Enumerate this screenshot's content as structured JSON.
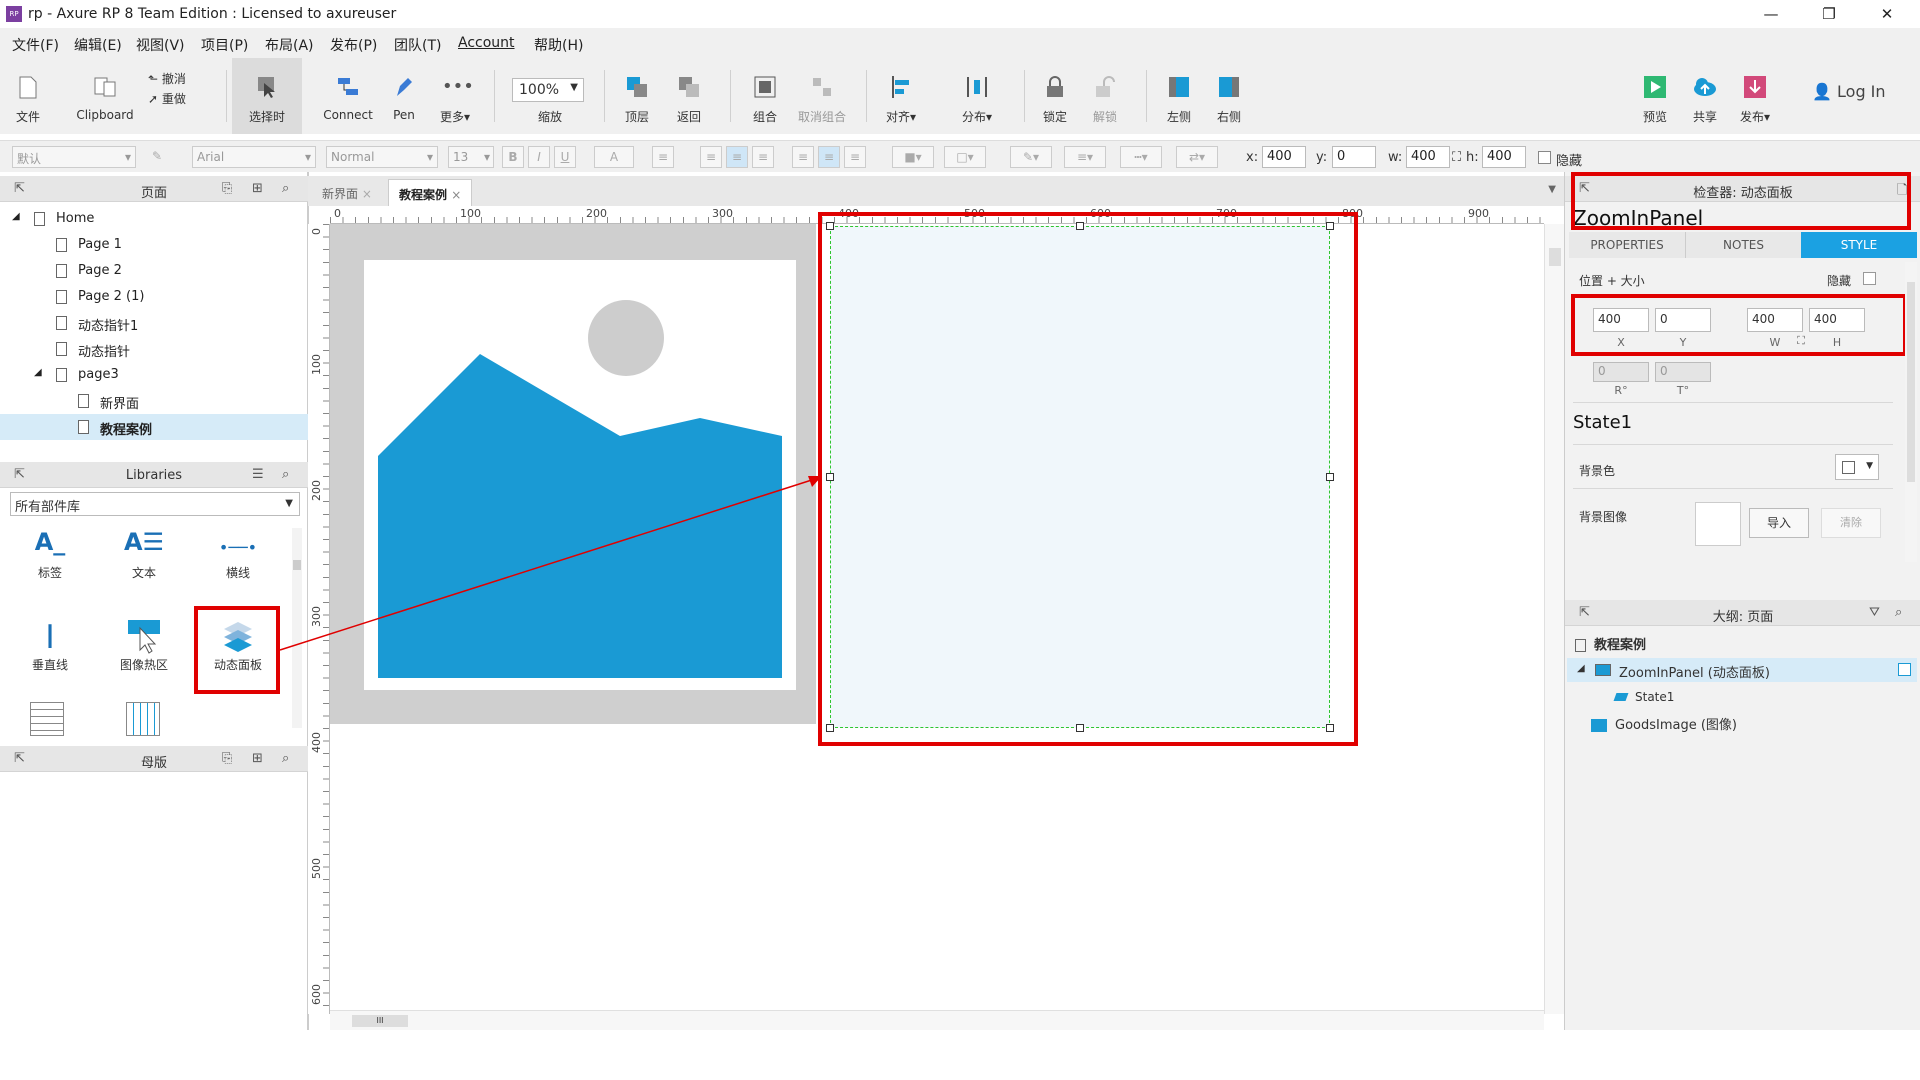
{
  "window": {
    "title": "rp - Axure RP 8 Team Edition : Licensed to axureuser",
    "icon_text": "RP",
    "minimize": "—",
    "maximize": "❐",
    "close": "✕"
  },
  "menu": [
    "文件(F)",
    "编辑(E)",
    "视图(V)",
    "项目(P)",
    "布局(A)",
    "发布(P)",
    "团队(T)",
    "Account",
    "帮助(H)"
  ],
  "toolbar": {
    "file": "文件",
    "clipboard": "Clipboard",
    "undo": "撤消",
    "redo": "重做",
    "select": "选择时",
    "connect": "Connect",
    "pen": "Pen",
    "more": "更多▾",
    "zoom": "100%",
    "zoom_label": "缩放",
    "top": "顶层",
    "back": "返回",
    "group": "组合",
    "ungroup": "取消组合",
    "align": "对齐▾",
    "distribute": "分布▾",
    "lock": "锁定",
    "unlock": "解锁",
    "left": "左侧",
    "right": "右侧",
    "preview": "预览",
    "share": "共享",
    "publish": "发布▾",
    "login": "Log In"
  },
  "format": {
    "style": "默认",
    "font": "Arial",
    "weight": "Normal",
    "size": "13",
    "bold": "B",
    "italic": "I",
    "underline": "U",
    "font_color": "A",
    "x_label": "x:",
    "x": "400",
    "y_label": "y:",
    "y": "0",
    "w_label": "w:",
    "w": "400",
    "h_label": "h:",
    "h": "400",
    "hide": "隐藏"
  },
  "pages": {
    "title": "页面",
    "items": [
      "Home",
      "Page 1",
      "Page 2",
      "Page 2 (1)",
      "动态指针1",
      "动态指针",
      "page3",
      "新界面",
      "教程案例"
    ]
  },
  "libraries": {
    "title": "Libraries",
    "selector": "所有部件库",
    "items": [
      "标签",
      "文本",
      "横线",
      "垂直线",
      "图像热区",
      "动态面板"
    ]
  },
  "masters": {
    "title": "母版"
  },
  "tabs": [
    "新界面",
    "教程案例"
  ],
  "ruler": {
    "h": [
      "0",
      "100",
      "200",
      "300",
      "400",
      "500",
      "600",
      "700",
      "800",
      "900"
    ],
    "v": [
      "0",
      "100",
      "200",
      "300",
      "400",
      "500",
      "600"
    ]
  },
  "inspector": {
    "title": "检查器: 动态面板",
    "name": "ZoomInPanel",
    "tabs": [
      "PROPERTIES",
      "NOTES",
      "STYLE"
    ],
    "pos_size": "位置 + 大小",
    "hide": "隐藏",
    "x": "400",
    "y": "0",
    "w": "400",
    "h": "400",
    "x_lbl": "X",
    "y_lbl": "Y",
    "w_lbl": "W",
    "h_lbl": "H",
    "r": "0",
    "t": "0",
    "r_lbl": "R°",
    "t_lbl": "T°",
    "state": "State1",
    "bg_color": "背景色",
    "bg_image": "背景图像",
    "import": "导入",
    "clear": "清除"
  },
  "outline": {
    "title": "大纲: 页面",
    "page": "教程案例",
    "items": [
      "ZoomInPanel (动态面板)",
      "State1",
      "GoodsImage (图像)"
    ]
  },
  "colors": {
    "accent": "#1ba1e2",
    "red": "#e00000",
    "image_blue": "#1a9ad4"
  }
}
